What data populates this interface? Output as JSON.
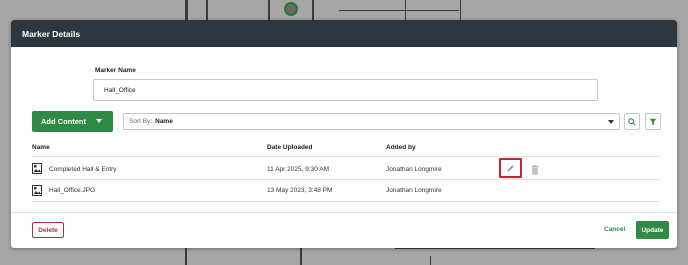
{
  "modal": {
    "title": "Marker Details"
  },
  "form": {
    "marker_name_label": "Marker Name",
    "marker_name_value": "Hall_Office"
  },
  "toolbar": {
    "add_content_label": "Add Content",
    "sort_prefix": "Sort By:",
    "sort_value": "Name"
  },
  "table": {
    "columns": [
      "Name",
      "Date Uploaded",
      "Added by"
    ],
    "rows": [
      {
        "name": "Completed Hall & Entry",
        "date": "11 Apr 2025, 9:30 AM",
        "added_by": "Jonathan Longmire"
      },
      {
        "name": "Hall_Office.JPG",
        "date": "13 May 2023, 3:48 PM",
        "added_by": "Jonathan Longmire"
      }
    ]
  },
  "footer": {
    "delete_label": "Delete",
    "cancel_label": "Cancel",
    "update_label": "Update"
  },
  "colors": {
    "header_bg": "#2e3740",
    "accent_green": "#2f8a46",
    "danger_red": "#b0303a",
    "highlight_red": "#c0282d"
  },
  "icons": {
    "search": "search-icon",
    "filter": "filter-icon",
    "edit": "pencil-icon",
    "trash": "trash-icon",
    "file": "image-file-icon"
  }
}
